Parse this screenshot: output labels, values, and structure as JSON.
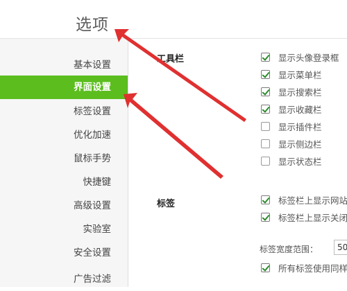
{
  "page_title": "选项",
  "sidebar": {
    "items": [
      {
        "label": "基本设置",
        "active": false
      },
      {
        "label": "界面设置",
        "active": true
      },
      {
        "label": "标签设置",
        "active": false
      },
      {
        "label": "优化加速",
        "active": false
      },
      {
        "label": "鼠标手势",
        "active": false
      },
      {
        "label": "快捷键",
        "active": false
      },
      {
        "label": "高级设置",
        "active": false
      },
      {
        "label": "实验室",
        "active": false
      },
      {
        "label": "安全设置",
        "active": false
      },
      {
        "label": "广告过滤",
        "active": false
      }
    ]
  },
  "toolbar_section": {
    "title": "工具栏",
    "options": [
      {
        "label": "显示头像登录框",
        "checked": true
      },
      {
        "label": "显示菜单栏",
        "checked": true
      },
      {
        "label": "显示搜索栏",
        "checked": true
      },
      {
        "label": "显示收藏栏",
        "checked": true
      },
      {
        "label": "显示插件栏",
        "checked": false
      },
      {
        "label": "显示侧边栏",
        "checked": false
      },
      {
        "label": "显示状态栏",
        "checked": false
      }
    ]
  },
  "tabs_section": {
    "title": "标签",
    "options": [
      {
        "label": "标签栏上显示网站",
        "checked": true
      },
      {
        "label": "标签栏上显示关闭",
        "checked": true
      }
    ],
    "width_label": "标签宽度范围：",
    "width_value": "50",
    "extra_option": {
      "label": "所有标签使用同样",
      "checked": true
    }
  },
  "colors": {
    "active_green": "#5cbd1f",
    "annotation_red": "#e03030"
  }
}
